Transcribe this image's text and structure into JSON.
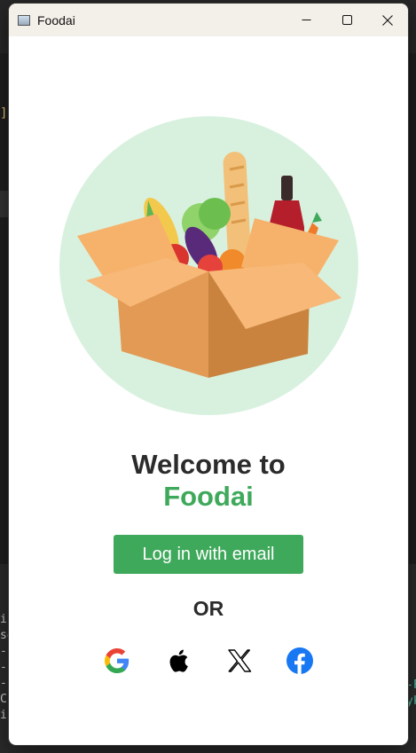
{
  "window": {
    "title": "Foodai",
    "controls": [
      "minimize",
      "maximize",
      "close"
    ]
  },
  "hero": {
    "icon": "grocery-box-illustration",
    "circle_color": "#d8f1df"
  },
  "headline": {
    "line1": "Welcome to",
    "line2": "Foodai"
  },
  "login": {
    "label": "Log in with email"
  },
  "divider": {
    "label": "OR"
  },
  "social": [
    {
      "name": "google",
      "icon": "google-icon"
    },
    {
      "name": "apple",
      "icon": "apple-icon"
    },
    {
      "name": "x",
      "icon": "x-icon"
    },
    {
      "name": "facebook",
      "icon": "facebook-icon"
    }
  ],
  "colors": {
    "brand": "#3fa95b",
    "text": "#2b2b2b",
    "titlebar": "#f3efe9"
  }
}
